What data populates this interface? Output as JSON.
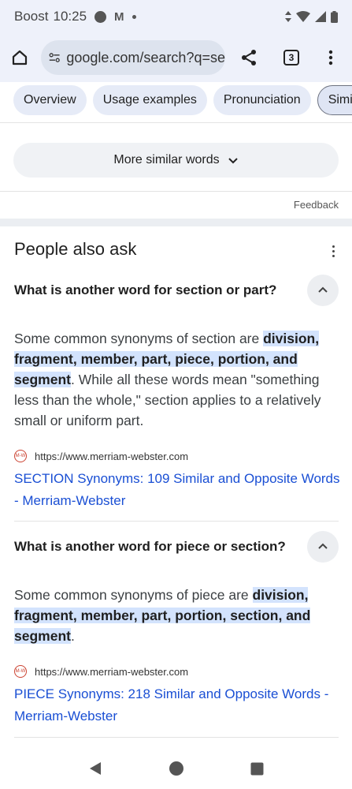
{
  "status": {
    "carrier": "Boost",
    "time": "10:25",
    "m_icon": "M"
  },
  "browser": {
    "url": "google.com/search?q=se",
    "tabs_count": "3",
    "icons": [
      "home-icon",
      "site-settings-icon",
      "share-icon",
      "tabs-icon",
      "more-vert-icon"
    ]
  },
  "chips": [
    "Overview",
    "Usage examples",
    "Pronunciation",
    "Simila"
  ],
  "more_similar_label": "More similar words",
  "feedback_label": "Feedback",
  "paa": {
    "title": "People also ask",
    "items": [
      {
        "question": "What is another word for section or part?",
        "answer_pre": "Some common synonyms of section are ",
        "answer_hl": "division, fragment, member, part, piece, portion, and segment",
        "answer_post": ". While all these words mean \"something less than the whole,\" section applies to a relatively small or uniform part.",
        "source_url": "https://www.merriam-webster.com",
        "favicon_text": "M-W",
        "link_text": "SECTION Synonyms: 109 Similar and Opposite Words - Merriam-Webster"
      },
      {
        "question": "What is another word for piece or section?",
        "answer_pre": "Some common synonyms of piece are ",
        "answer_hl": "division, fragment, member, part, portion, section, and segment",
        "answer_post": ".",
        "source_url": "https://www.merriam-webster.com",
        "favicon_text": "M-W",
        "link_text": "PIECE Synonyms: 218 Similar and Opposite Words - Merriam-Webster"
      }
    ]
  },
  "colors": {
    "link": "#1a4fd4",
    "highlight": "#d3e3fd",
    "chip_bg": "#e6ebf7",
    "bar_bg": "#eef1fa"
  }
}
